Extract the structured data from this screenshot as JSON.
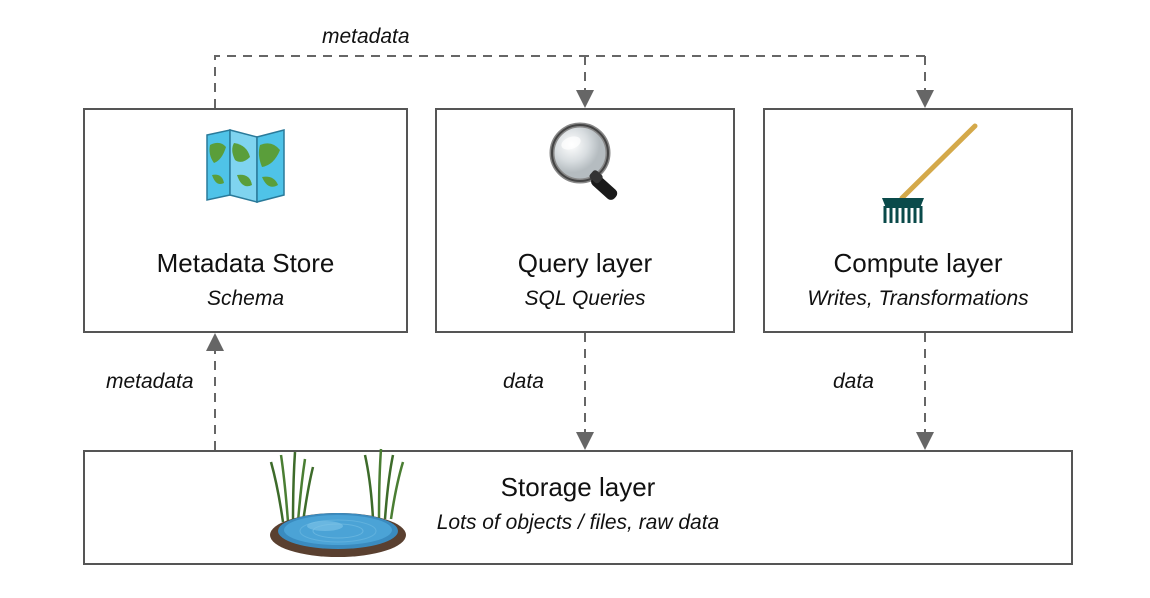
{
  "diagram": {
    "top_label": "metadata",
    "boxes": {
      "metadata_store": {
        "title": "Metadata Store",
        "subtitle": "Schema",
        "icon": "map-icon"
      },
      "query_layer": {
        "title": "Query layer",
        "subtitle": "SQL Queries",
        "icon": "magnifier-icon"
      },
      "compute_layer": {
        "title": "Compute layer",
        "subtitle": "Writes, Transformations",
        "icon": "rake-icon"
      },
      "storage_layer": {
        "title": "Storage layer",
        "subtitle": "Lots of objects / files, raw data",
        "icon": "pond-icon"
      }
    },
    "arrows": {
      "metadata_up": "metadata",
      "data_query": "data",
      "data_compute": "data"
    }
  }
}
